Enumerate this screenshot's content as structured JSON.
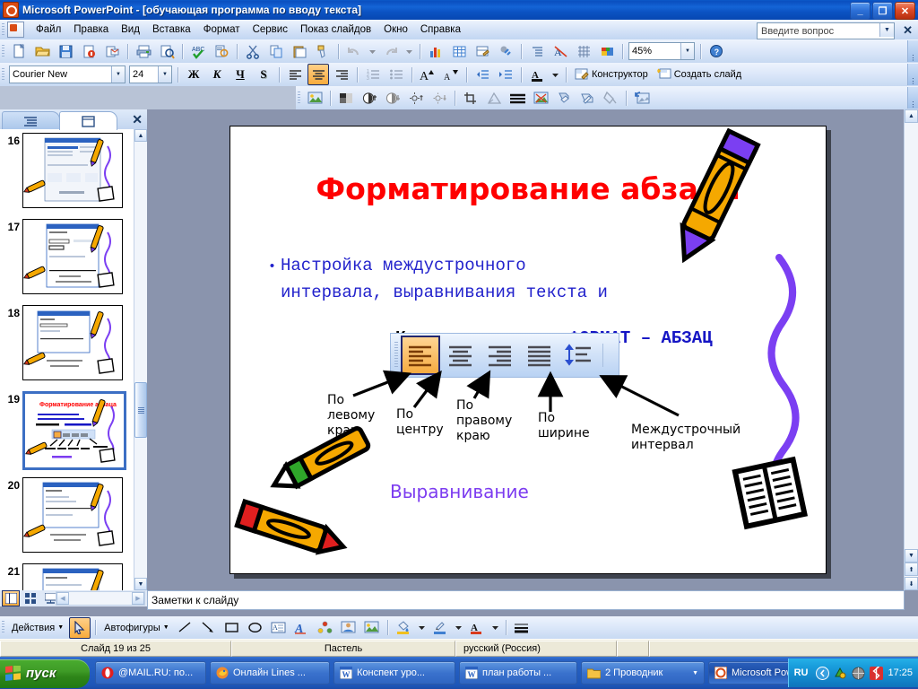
{
  "window": {
    "app_name": "Microsoft PowerPoint",
    "document_title": "[обучающая программа по вводу текста]",
    "title": "Microsoft PowerPoint - [обучающая программа по вводу текста]",
    "minimize_label": "_",
    "restore_label": "❐",
    "close_label": "✕"
  },
  "menu": {
    "items": [
      {
        "label": "Файл"
      },
      {
        "label": "Правка"
      },
      {
        "label": "Вид"
      },
      {
        "label": "Вставка"
      },
      {
        "label": "Формат"
      },
      {
        "label": "Сервис"
      },
      {
        "label": "Показ слайдов"
      },
      {
        "label": "Окно"
      },
      {
        "label": "Справка"
      }
    ],
    "ask_placeholder": "Введите вопрос",
    "close_label": "✕"
  },
  "standard_toolbar": {
    "buttons": [
      {
        "name": "new-document",
        "title": "Создать"
      },
      {
        "name": "open-document",
        "title": "Открыть"
      },
      {
        "name": "save-document",
        "title": "Сохранить"
      },
      {
        "name": "permission",
        "title": "Разрешение"
      },
      {
        "name": "email",
        "title": "Сообщение"
      },
      {
        "name": "print",
        "title": "Печать"
      },
      {
        "name": "print-preview",
        "title": "Предварительный просмотр"
      },
      {
        "name": "spelling",
        "title": "Правописание"
      },
      {
        "name": "research",
        "title": "Справочные материалы"
      },
      {
        "name": "cut",
        "title": "Вырезать"
      },
      {
        "name": "copy",
        "title": "Копировать"
      },
      {
        "name": "paste",
        "title": "Вставить"
      },
      {
        "name": "format-painter",
        "title": "Формат по образцу"
      },
      {
        "name": "undo",
        "title": "Отменить"
      },
      {
        "name": "redo",
        "title": "Вернуть"
      },
      {
        "name": "insert-chart",
        "title": "Диаграмма"
      },
      {
        "name": "insert-table",
        "title": "Таблица"
      },
      {
        "name": "table-and-borders",
        "title": "Таблицы и границы"
      },
      {
        "name": "insert-hyperlink",
        "title": "Гиперссылка"
      },
      {
        "name": "expand-animation",
        "title": "Развернуть"
      },
      {
        "name": "show-formatting",
        "title": "Показать форматирование"
      },
      {
        "name": "show-grid",
        "title": "Сетка"
      },
      {
        "name": "color-scheme",
        "title": "Цветовая схема"
      }
    ],
    "zoom_value": "45%",
    "help_title": "Справка"
  },
  "formatting_toolbar": {
    "font_name": "Courier New",
    "font_size": "24",
    "bold_label": "Ж",
    "italic_label": "К",
    "underline_label": "Ч",
    "shadow_label": "S",
    "align_left_title": "По левому краю",
    "align_center_title": "По центру",
    "align_right_title": "По правому краю",
    "numbering_title": "Нумерованный список",
    "bullets_title": "Маркированный список",
    "increase_font_label": "A",
    "decrease_font_label": "A",
    "decrease_indent_title": "Уменьшить отступ",
    "increase_indent_title": "Увеличить отступ",
    "font_color_label": "A",
    "design_label": "Конструктор",
    "new_slide_label": "Создать слайд"
  },
  "picture_toolbar": {
    "buttons": [
      {
        "name": "insert-picture"
      },
      {
        "name": "color-mode"
      },
      {
        "name": "more-contrast"
      },
      {
        "name": "less-contrast"
      },
      {
        "name": "more-brightness"
      },
      {
        "name": "less-brightness"
      },
      {
        "name": "crop"
      },
      {
        "name": "rotate-left"
      },
      {
        "name": "line-style"
      },
      {
        "name": "compress-pictures"
      },
      {
        "name": "recolor-picture"
      },
      {
        "name": "format-picture"
      },
      {
        "name": "set-transparent-color"
      },
      {
        "name": "reset-picture"
      }
    ]
  },
  "slides_pane": {
    "tab_outline": "Структура",
    "tab_slides": "Слайды",
    "close_label": "✕",
    "selected_slide": 19,
    "thumbnails": [
      {
        "number": "16"
      },
      {
        "number": "17"
      },
      {
        "number": "18"
      },
      {
        "number": "19"
      },
      {
        "number": "20"
      },
      {
        "number": "21"
      }
    ]
  },
  "slide": {
    "title": "Форматирование абзаца",
    "bullet_line1": "Настройка междустрочного",
    "bullet_line2": "интервала, выравнивания текста и",
    "command_prefix": "Команда меню:",
    "command_value": "ФОРМАТ – АБЗАЦ",
    "alignment_word": "Выравнивание",
    "toolbar_buttons": [
      {
        "name": "align-left",
        "selected": true
      },
      {
        "name": "align-center",
        "selected": false
      },
      {
        "name": "align-right",
        "selected": false
      },
      {
        "name": "align-justify",
        "selected": false
      },
      {
        "name": "line-spacing",
        "selected": false
      }
    ],
    "callouts": [
      {
        "name": "callout-align-left",
        "line1": "По",
        "line2": "левому",
        "line3": "краю"
      },
      {
        "name": "callout-align-center",
        "line1": "По",
        "line2": "центру",
        "line3": ""
      },
      {
        "name": "callout-align-right",
        "line1": "По",
        "line2": "правому",
        "line3": "краю"
      },
      {
        "name": "callout-align-justify",
        "line1": "По",
        "line2": "ширине",
        "line3": ""
      },
      {
        "name": "callout-line-spacing",
        "line1": "Междустрочный",
        "line2": "интервал",
        "line3": ""
      }
    ],
    "colors": {
      "title": "#ff0000",
      "bullet": "#2222cc",
      "command_value": "#1515c4",
      "alignment_word": "#7c3cf0",
      "crayon_body": "#f5a800",
      "crayon_tip": "#7b3ff2"
    }
  },
  "notes": {
    "placeholder": "Заметки к слайду"
  },
  "drawing_toolbar": {
    "actions_label": "Действия",
    "autoshapes_label": "Автофигуры",
    "buttons": [
      {
        "name": "select-objects"
      },
      {
        "name": "line"
      },
      {
        "name": "arrow"
      },
      {
        "name": "rectangle"
      },
      {
        "name": "oval"
      },
      {
        "name": "text-box"
      },
      {
        "name": "word-art"
      },
      {
        "name": "diagram"
      },
      {
        "name": "clip-art"
      },
      {
        "name": "picture"
      },
      {
        "name": "fill-color"
      },
      {
        "name": "line-color"
      },
      {
        "name": "font-color"
      },
      {
        "name": "line-style"
      }
    ]
  },
  "status_bar": {
    "slide_counter": "Слайд 19 из 25",
    "design_template": "Пастель",
    "language": "русский (Россия)"
  },
  "taskbar": {
    "start_label": "пуск",
    "items": [
      {
        "name": "taskbar-item-mail",
        "label": "@MAIL.RU: по...",
        "icon": "opera-icon",
        "active": false
      },
      {
        "name": "taskbar-item-lines",
        "label": "Онлайн Lines ...",
        "icon": "firefox-icon",
        "active": false
      },
      {
        "name": "taskbar-item-konspekt",
        "label": "Конспект уро...",
        "icon": "word-icon",
        "active": false
      },
      {
        "name": "taskbar-item-plan",
        "label": "план работы ...",
        "icon": "word-icon",
        "active": false
      },
      {
        "name": "taskbar-item-explorer",
        "label": "2 Проводник",
        "icon": "folder-icon",
        "active": false
      },
      {
        "name": "taskbar-item-powerpoint",
        "label": "Microsoft Pow...",
        "icon": "powerpoint-icon",
        "active": true
      }
    ],
    "language_indicator": "RU",
    "clock": "17:25"
  }
}
